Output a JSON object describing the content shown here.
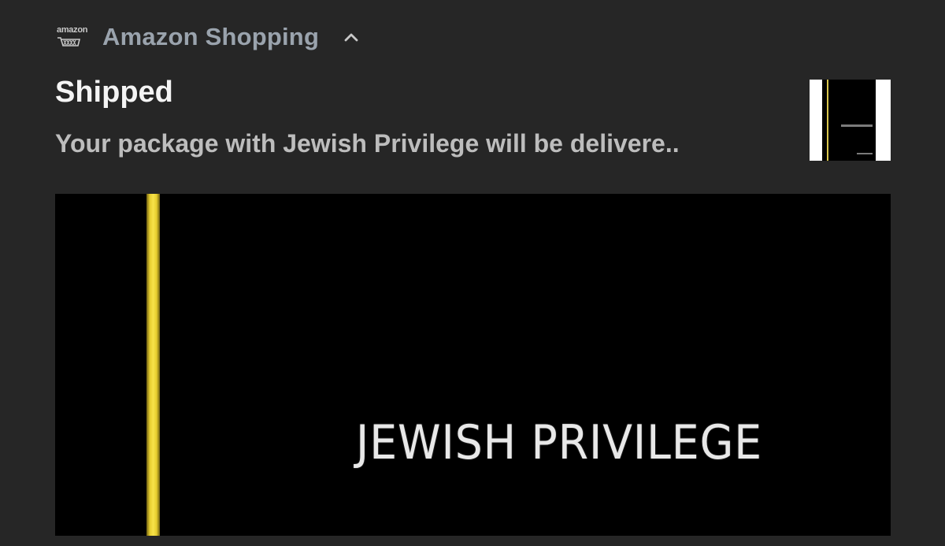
{
  "notification": {
    "app": {
      "icon_label": "amazon",
      "icon": "amazon-cart-icon",
      "name": "Amazon Shopping",
      "expand_icon": "chevron-up-icon"
    },
    "title": "Shipped",
    "body": "Your package with Jewish Privilege will be delivere..",
    "thumbnail": "book-cover-thumbnail",
    "image": {
      "cover_text": "JEWISH PRIVILEGE"
    }
  },
  "colors": {
    "background": "#262626",
    "app_name": "#9aa3ad",
    "title": "#f4f4f4",
    "body": "#bdbdbd",
    "stripe": "#f7e24a"
  }
}
